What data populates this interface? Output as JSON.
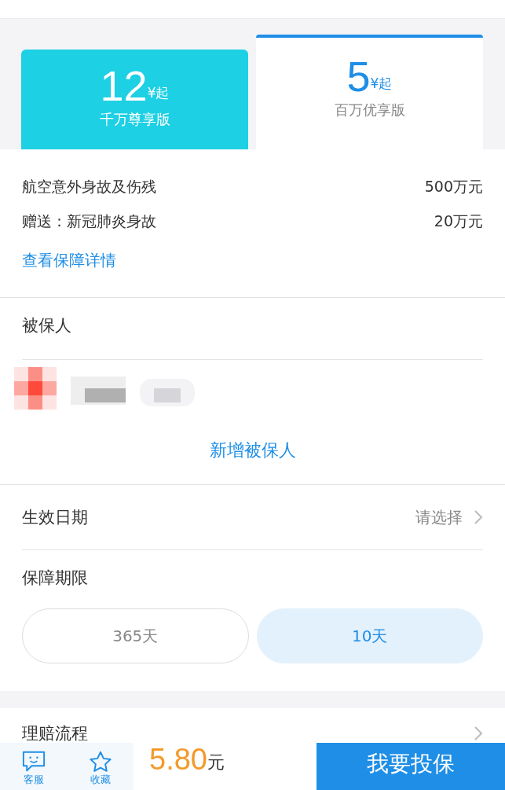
{
  "plans": [
    {
      "price": "12",
      "unit": "¥起",
      "name": "千万尊享版",
      "selected": false
    },
    {
      "price": "5",
      "unit": "¥起",
      "name": "百万优享版",
      "selected": true
    }
  ],
  "coverage": [
    {
      "label": "航空意外身故及伤残",
      "amount": "500万元"
    },
    {
      "label": "赠送：新冠肺炎身故",
      "amount": "20万元"
    }
  ],
  "details_link": "查看保障详情",
  "insured": {
    "title": "被保人",
    "add_button": "新增被保人"
  },
  "effective_date": {
    "label": "生效日期",
    "value": "请选择"
  },
  "term": {
    "label": "保障期限",
    "options": [
      {
        "label": "365天",
        "selected": false
      },
      {
        "label": "10天",
        "selected": true
      }
    ]
  },
  "claims": {
    "label": "理赔流程"
  },
  "bottom_bar": {
    "actions": [
      {
        "label": "客服",
        "kind": "chat"
      },
      {
        "label": "收藏",
        "kind": "star"
      }
    ],
    "price": "5.80",
    "currency": "元",
    "buy_button": "我要投保"
  }
}
